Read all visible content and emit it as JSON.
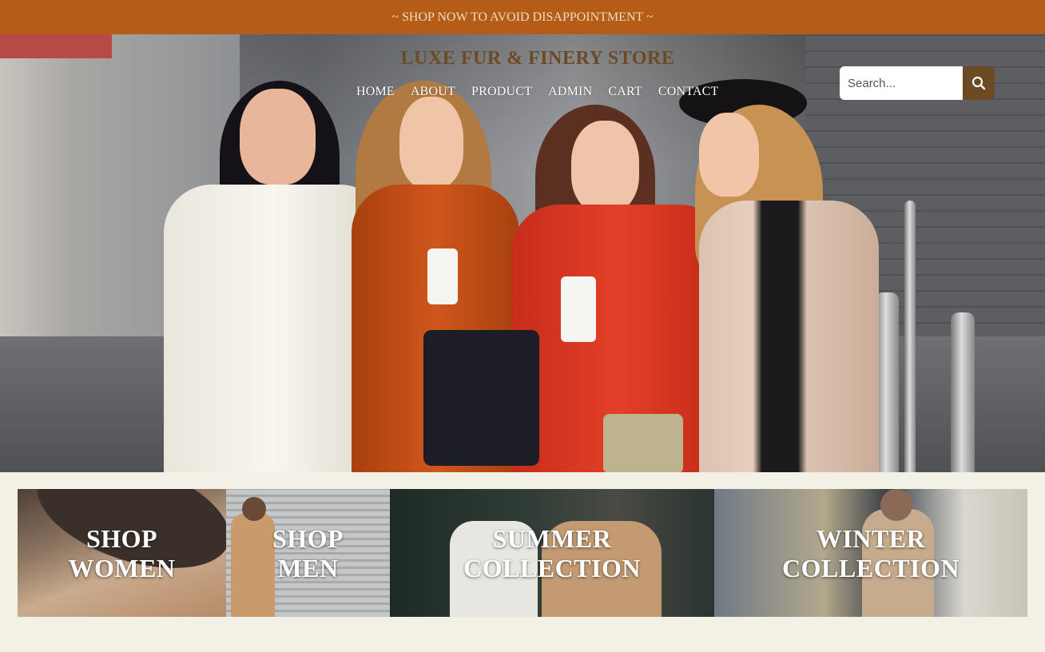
{
  "promo": {
    "text": "~ SHOP NOW TO AVOID DISAPPOINTMENT ~"
  },
  "header": {
    "brand": "LUXE FUR & FINERY STORE",
    "nav": [
      {
        "label": "HOME"
      },
      {
        "label": "ABOUT"
      },
      {
        "label": "PRODUCT"
      },
      {
        "label": "ADMIN"
      },
      {
        "label": "CART"
      },
      {
        "label": "CONTACT"
      }
    ]
  },
  "search": {
    "placeholder": "Search...",
    "icon": "search-icon"
  },
  "hero": {
    "image": "four women in coats walking with coffee cups"
  },
  "collections": [
    {
      "line1": "SHOP",
      "line2": "WOMEN"
    },
    {
      "line1": "SHOP",
      "line2": "MEN"
    },
    {
      "line1": "SUMMER",
      "line2": "COLLECTION"
    },
    {
      "line1": "WINTER",
      "line2": "COLLECTION"
    }
  ],
  "colors": {
    "promo_bar": "#b45d19",
    "brand_brown": "#6b4a24",
    "page_background": "#f3f0e6"
  }
}
